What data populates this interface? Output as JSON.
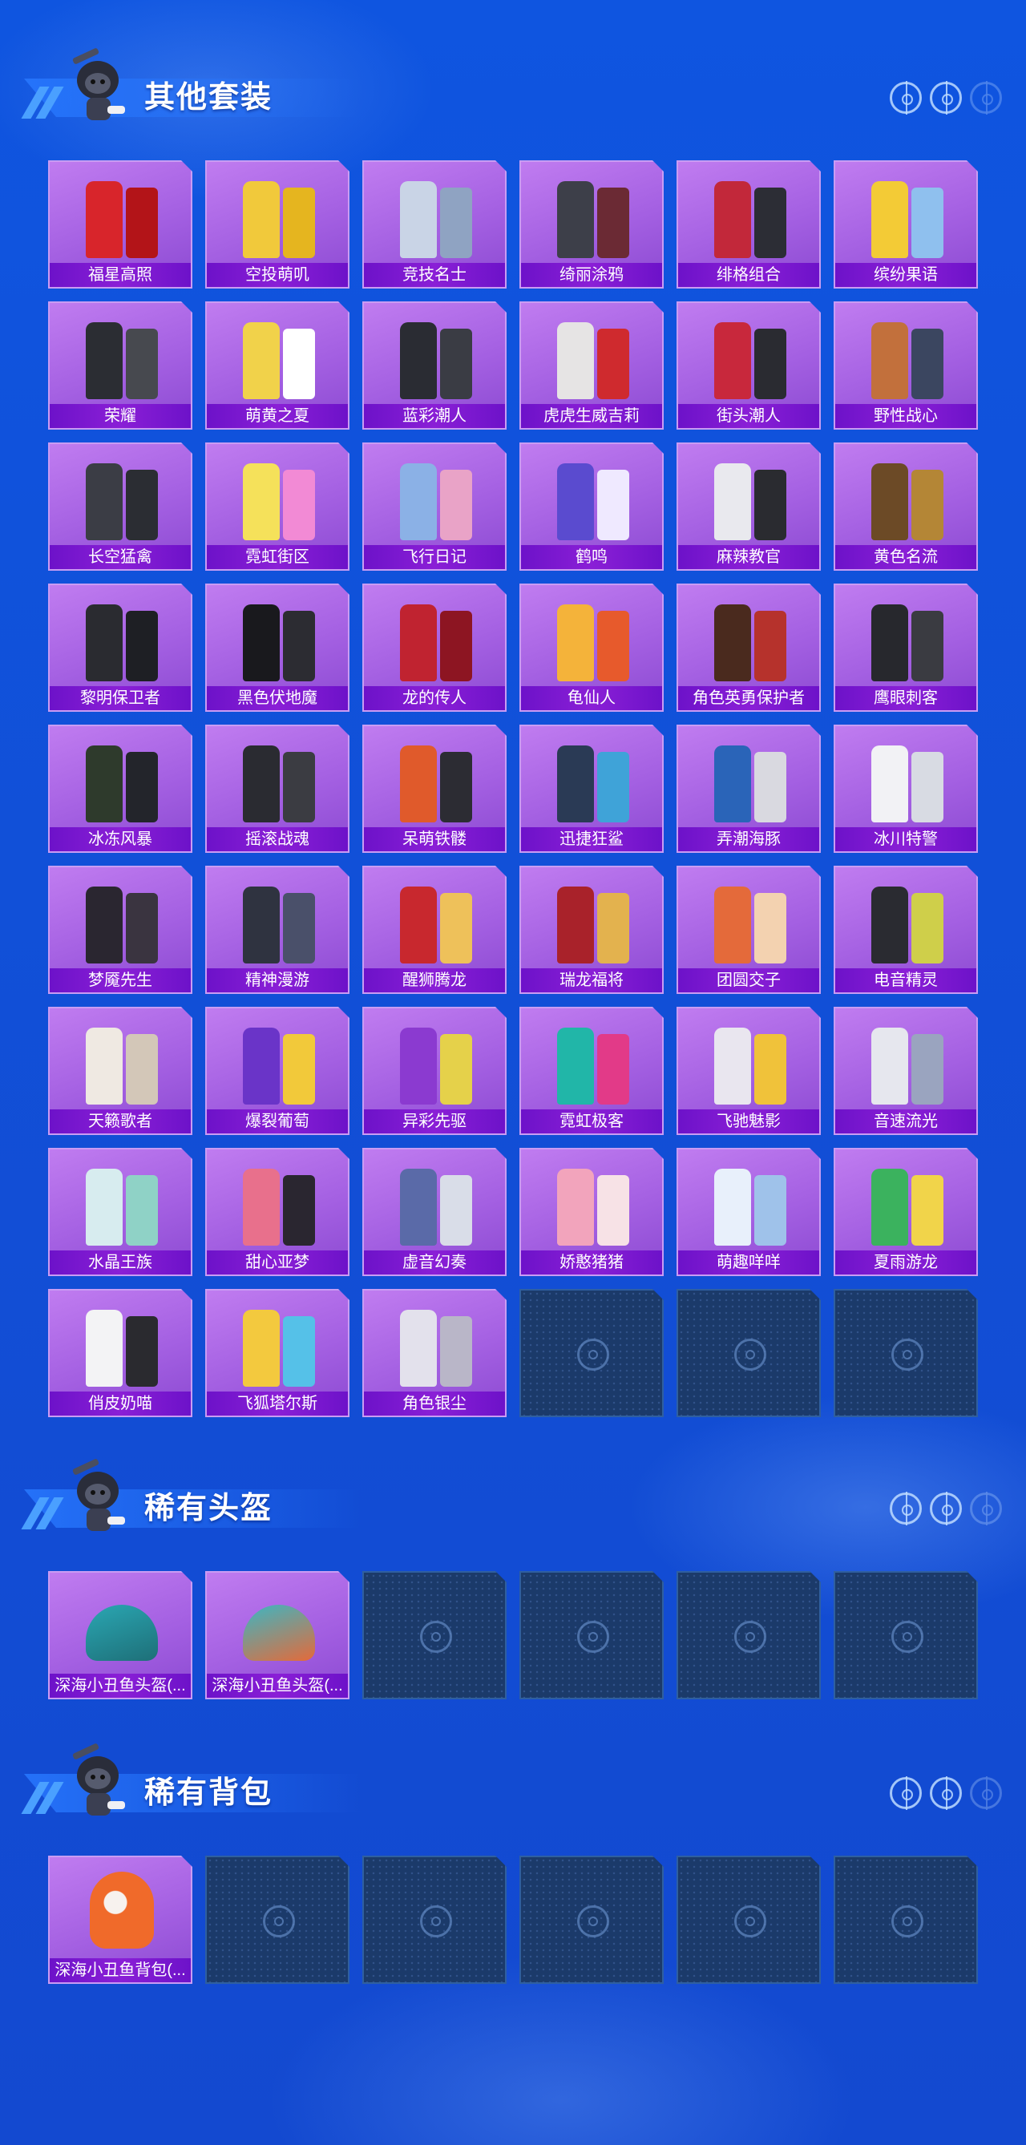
{
  "sections": [
    {
      "title": "其他套装",
      "items": [
        {
          "label": "福星高照",
          "colors": [
            "#d8252b",
            "#b31418"
          ]
        },
        {
          "label": "空投萌叽",
          "colors": [
            "#f1c93b",
            "#e5b51f"
          ]
        },
        {
          "label": "竞技名士",
          "colors": [
            "#c9d4e6",
            "#8fa3c2"
          ]
        },
        {
          "label": "绮丽涂鸦",
          "colors": [
            "#3d3f49",
            "#6b2a34"
          ]
        },
        {
          "label": "绯格组合",
          "colors": [
            "#c2283a",
            "#2c2d35"
          ]
        },
        {
          "label": "缤纷果语",
          "colors": [
            "#f3cb36",
            "#8fc0ee"
          ]
        },
        {
          "label": "荣耀",
          "colors": [
            "#2b2d33",
            "#47494f"
          ]
        },
        {
          "label": "萌黄之夏",
          "colors": [
            "#f1d24a",
            "#ffffff"
          ]
        },
        {
          "label": "蓝彩潮人",
          "colors": [
            "#2a2c33",
            "#3a3c44"
          ]
        },
        {
          "label": "虎虎生威吉莉",
          "colors": [
            "#e6e4e4",
            "#cf2a2e"
          ]
        },
        {
          "label": "街头潮人",
          "colors": [
            "#c8283c",
            "#2a2b31"
          ]
        },
        {
          "label": "野性战心",
          "colors": [
            "#c2703c",
            "#3b4660"
          ]
        },
        {
          "label": "长空猛禽",
          "colors": [
            "#3b3d45",
            "#2b2d33"
          ]
        },
        {
          "label": "霓虹街区",
          "colors": [
            "#f5e15a",
            "#f28ad5"
          ]
        },
        {
          "label": "飞行日记",
          "colors": [
            "#8bb1e6",
            "#e9a3c7"
          ]
        },
        {
          "label": "鹤鸣",
          "colors": [
            "#5a4bcf",
            "#efe9ff"
          ]
        },
        {
          "label": "麻辣教官",
          "colors": [
            "#e9e9ee",
            "#2a2b30"
          ]
        },
        {
          "label": "黄色名流",
          "colors": [
            "#6c4a26",
            "#b48636"
          ]
        },
        {
          "label": "黎明保卫者",
          "colors": [
            "#2a2b30",
            "#1e1f24"
          ]
        },
        {
          "label": "黑色伏地魔",
          "colors": [
            "#19191d",
            "#2c2c32"
          ]
        },
        {
          "label": "龙的传人",
          "colors": [
            "#c02330",
            "#8d1522"
          ]
        },
        {
          "label": "龟仙人",
          "colors": [
            "#f4b33a",
            "#e75a2c"
          ]
        },
        {
          "label": "角色英勇保护者",
          "colors": [
            "#4a2a1e",
            "#b6322c"
          ]
        },
        {
          "label": "鹰眼刺客",
          "colors": [
            "#27282d",
            "#3a3b41"
          ]
        },
        {
          "label": "冰冻风暴",
          "colors": [
            "#2e3a2c",
            "#23252b"
          ]
        },
        {
          "label": "摇滚战魂",
          "colors": [
            "#2a2b31",
            "#3b3c42"
          ]
        },
        {
          "label": "呆萌铁髅",
          "colors": [
            "#e05a2b",
            "#2c2c33"
          ]
        },
        {
          "label": "迅捷狂鲨",
          "colors": [
            "#2a3a55",
            "#3fa3d8"
          ]
        },
        {
          "label": "弄潮海豚",
          "colors": [
            "#2a64b8",
            "#d9d9e0"
          ]
        },
        {
          "label": "冰川特警",
          "colors": [
            "#f2f2f5",
            "#d8dbe3"
          ]
        },
        {
          "label": "梦魇先生",
          "colors": [
            "#2a2630",
            "#3a3440"
          ]
        },
        {
          "label": "精神漫游",
          "colors": [
            "#2f3340",
            "#4a506a"
          ]
        },
        {
          "label": "醒狮腾龙",
          "colors": [
            "#c8282e",
            "#eec15a"
          ]
        },
        {
          "label": "瑞龙福将",
          "colors": [
            "#a9222a",
            "#e3b24e"
          ]
        },
        {
          "label": "团圆交子",
          "colors": [
            "#e46a3a",
            "#f3d2b0"
          ]
        },
        {
          "label": "电音精灵",
          "colors": [
            "#2a2b31",
            "#cfcf4a"
          ]
        },
        {
          "label": "天籁歌者",
          "colors": [
            "#efe9e2",
            "#d3c7b8"
          ]
        },
        {
          "label": "爆裂葡萄",
          "colors": [
            "#6a34c8",
            "#f2c93a"
          ]
        },
        {
          "label": "异彩先驱",
          "colors": [
            "#8b3ad0",
            "#e5d14a"
          ]
        },
        {
          "label": "霓虹极客",
          "colors": [
            "#21b6a8",
            "#e23a88"
          ]
        },
        {
          "label": "飞驰魅影",
          "colors": [
            "#e9e6ef",
            "#f0c23a"
          ]
        },
        {
          "label": "音速流光",
          "colors": [
            "#e6e7ee",
            "#9aa4bf"
          ]
        },
        {
          "label": "水晶王族",
          "colors": [
            "#d7ecef",
            "#8fd2c6"
          ]
        },
        {
          "label": "甜心亚梦",
          "colors": [
            "#e8708c",
            "#2a2630"
          ]
        },
        {
          "label": "虚音幻奏",
          "colors": [
            "#5a6aa8",
            "#d9dde8"
          ]
        },
        {
          "label": "娇憨猪猪",
          "colors": [
            "#f2a4bc",
            "#f7e2e6"
          ]
        },
        {
          "label": "萌趣咩咩",
          "colors": [
            "#e8f0fb",
            "#9fc2ea"
          ]
        },
        {
          "label": "夏雨游龙",
          "colors": [
            "#3bb25e",
            "#f1d44a"
          ]
        },
        {
          "label": "俏皮奶喵",
          "colors": [
            "#f3f3f5",
            "#2a2a2f"
          ]
        },
        {
          "label": "飞狐塔尔斯",
          "colors": [
            "#f3c93e",
            "#55c1e8"
          ]
        },
        {
          "label": "角色银尘",
          "colors": [
            "#e3e1ec",
            "#b9b6c8"
          ]
        }
      ],
      "empty_slots": 3
    },
    {
      "title": "稀有头盔",
      "items": [
        {
          "label": "深海小丑鱼头盔(...",
          "colors": [
            "#2aa7b3",
            "#1e6f78"
          ]
        },
        {
          "label": "深海小丑鱼头盔(...",
          "colors": [
            "#3bb7c4",
            "#e46a3a"
          ]
        }
      ],
      "empty_slots": 4
    },
    {
      "title": "稀有背包",
      "items": [
        {
          "label": "深海小丑鱼背包(...",
          "colors": [
            "#f06a2a",
            "#f7f2ee"
          ]
        }
      ],
      "empty_slots": 5
    }
  ],
  "icons": {
    "target": "crosshair-target-icon",
    "mascot": "mascot-character-icon",
    "empty_slot": "empty-slot-crosshair-icon"
  }
}
